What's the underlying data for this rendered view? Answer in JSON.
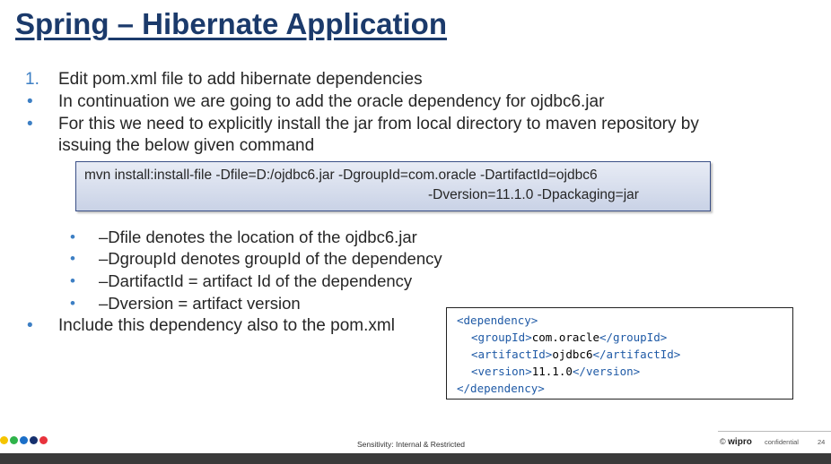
{
  "title": "Spring – Hibernate Application",
  "bullets": [
    {
      "marker": "1.",
      "text": "Edit pom.xml file to add hibernate dependencies"
    },
    {
      "marker": "•",
      "text": "In continuation we are going to add the oracle dependency for ojdbc6.jar"
    },
    {
      "marker": "•",
      "text": "For this we need to explicitly install the jar from local directory to maven repository by"
    },
    {
      "marker": "",
      "text": "issuing the below given command"
    }
  ],
  "command": {
    "line1": "mvn install:install-file -Dfile=D:/ojdbc6.jar -DgroupId=com.oracle -DartifactId=ojdbc6",
    "line2": "-Dversion=11.1.0  -Dpackaging=jar"
  },
  "sub_bullets": [
    {
      "marker": "•",
      "text": "–Dfile denotes the location of the ojdbc6.jar"
    },
    {
      "marker": "•",
      "text": "–DgroupId denotes groupId of the dependency"
    },
    {
      "marker": "•",
      "text": "–DartifactId  = artifact Id of the dependency"
    },
    {
      "marker": "•",
      "text": "–Dversion = artifact version"
    }
  ],
  "last_bullet": {
    "marker": "•",
    "text": "Include this dependency also to the pom.xml"
  },
  "code": {
    "l1_open": "<dependency>",
    "l2_open": "<groupId>",
    "l2_val": "com.oracle",
    "l2_close": "</groupId>",
    "l3_open": "<artifactId>",
    "l3_val": "ojdbc6",
    "l3_close": "</artifactId>",
    "l4_open": "<version>",
    "l4_val": "11.1.0",
    "l4_close": "</version>",
    "l5_close": "</dependency>"
  },
  "footer": {
    "sensitivity": "Sensitivity: Internal & Restricted",
    "copyright": "©",
    "brand": "wipro",
    "confidential": "confidential",
    "page": "24",
    "dot_colors": [
      "#f5c400",
      "#2fb34a",
      "#1b6fc8",
      "#16306e",
      "#e8323c"
    ]
  }
}
